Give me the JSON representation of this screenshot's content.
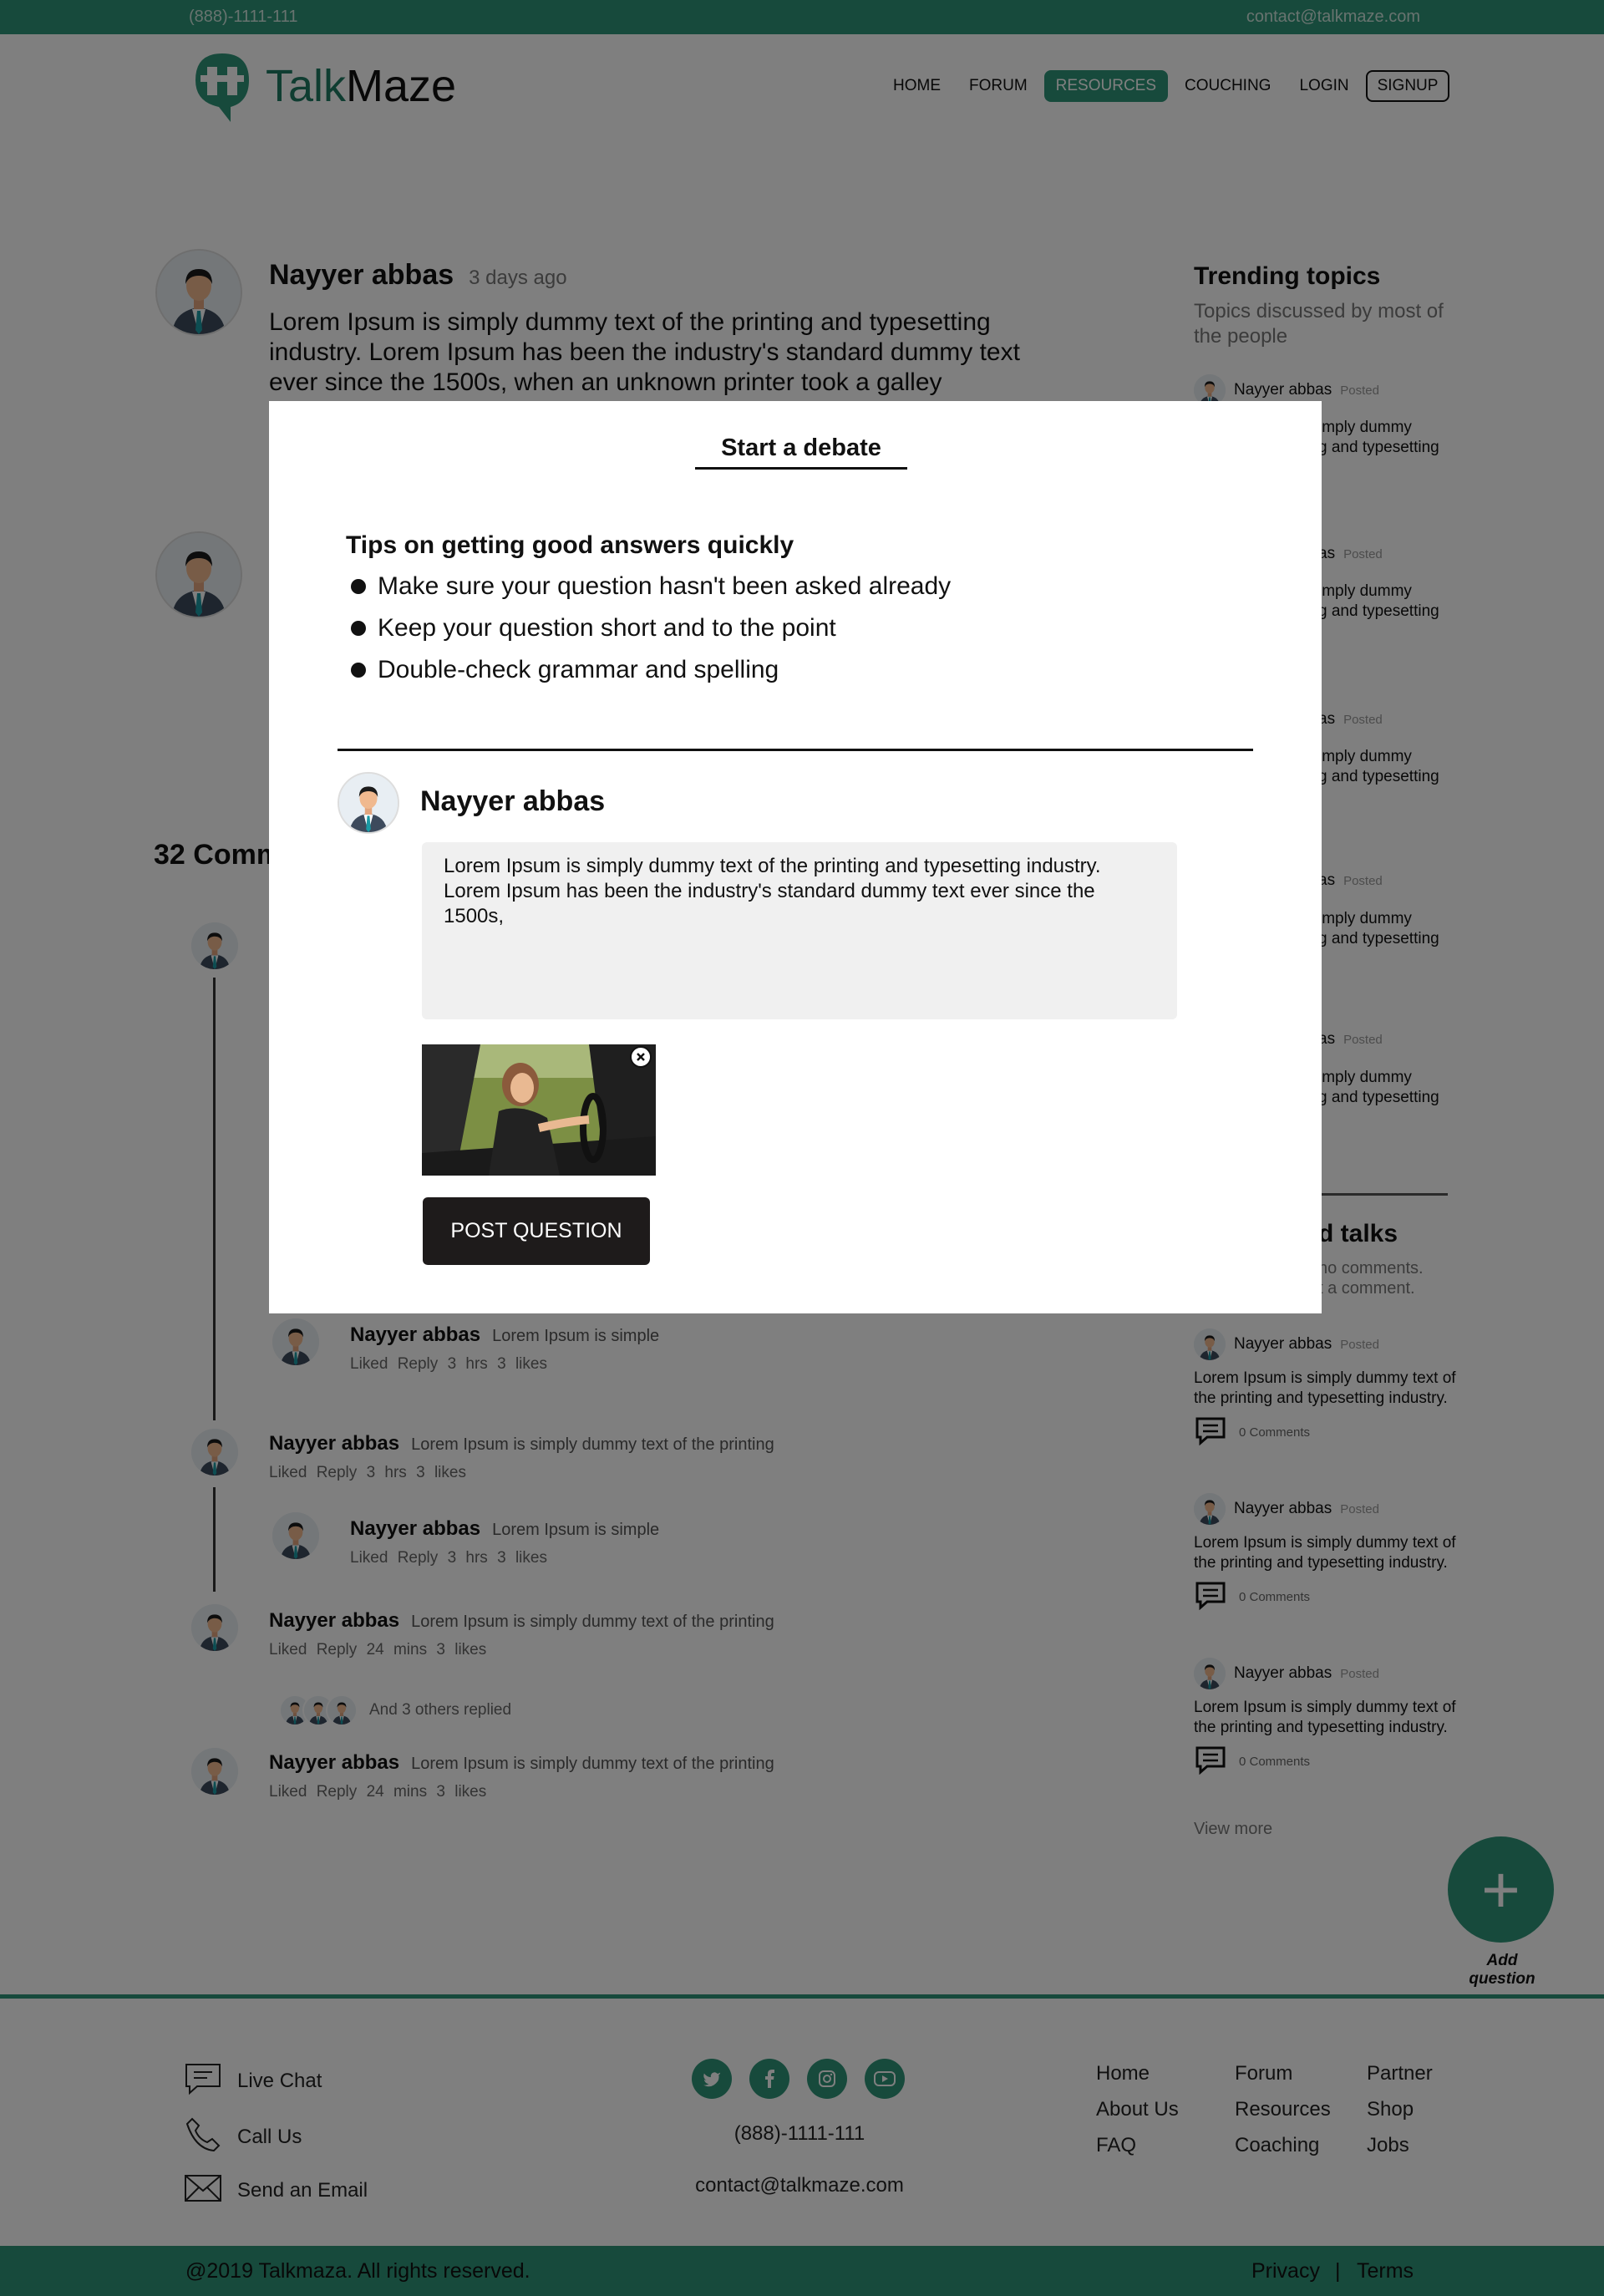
{
  "topbar": {
    "phone": "(888)-1111-111",
    "email": "contact@talkmaze.com"
  },
  "brand": {
    "part1": "Talk",
    "part2": "Maze",
    "accent": "#2f9478"
  },
  "nav": {
    "home": "HOME",
    "forum": "FORUM",
    "resources": "RESOURCES",
    "couching": "COUCHING",
    "login": "LOGIN",
    "signup": "SIGNUP"
  },
  "post": {
    "author": "Nayyer abbas",
    "time": "3 days ago",
    "body": "Lorem Ipsum is simply dummy text of the printing and typesetting industry. Lorem Ipsum has been the industry's standard dummy text ever since the 1500s, when an unknown printer took a galley"
  },
  "comments_header": "32 Comm",
  "comments": [
    {
      "author": "Nayyer abbas",
      "text": "Lorem Ipsum is simple",
      "liked": "Liked",
      "reply": "Reply",
      "time": "3 hrs",
      "likes": "3 likes"
    },
    {
      "author": "Nayyer abbas",
      "text": "Lorem Ipsum is simply dummy text of the printing",
      "liked": "Liked",
      "reply": "Reply",
      "time": "3 hrs",
      "likes": "3 likes"
    },
    {
      "author": "Nayyer abbas",
      "text": "Lorem Ipsum is simple",
      "liked": "Liked",
      "reply": "Reply",
      "time": "3 hrs",
      "likes": "3 likes"
    },
    {
      "author": "Nayyer abbas",
      "text": "Lorem Ipsum is simply dummy text of the printing",
      "liked": "Liked",
      "reply": "Reply",
      "time": "24 mins",
      "likes": "3 likes"
    },
    {
      "author": "Nayyer abbas",
      "text": "Lorem Ipsum is simply dummy text of the printing",
      "liked": "Liked",
      "reply": "Reply",
      "time": "24 mins",
      "likes": "3 likes"
    }
  ],
  "others_replied": "And 3 others replied",
  "sidebar": {
    "trending_title": "Trending topics",
    "trending_sub": "Topics discussed by most of the people",
    "trending_items": [
      {
        "author": "Nayyer abbas",
        "posted": "Posted",
        "body_tail": "imply dummy",
        "body_tail2": "g and typesetting"
      },
      {
        "author_tail": "as",
        "posted": "Posted",
        "body_tail": "imply dummy",
        "body_tail2": "g and typesetting"
      },
      {
        "author_tail": "as",
        "posted": "Posted",
        "body_tail": "imply dummy",
        "body_tail2": "g and typesetting"
      },
      {
        "author_tail": "as",
        "posted": "Posted",
        "body_tail": "imply dummy",
        "body_tail2": "g and typesetting"
      },
      {
        "author_tail": "as",
        "posted": "Posted",
        "body_tail": "imply dummy",
        "body_tail2": "g and typesetting"
      }
    ],
    "related_title_tail": "d talks",
    "related_sub1": "no comments.",
    "related_sub2": "t a comment.",
    "related_items": [
      {
        "author": "Nayyer abbas",
        "posted": "Posted",
        "body": "Lorem Ipsum is simply dummy text of the printing and typesetting industry.",
        "comments": "0 Comments"
      },
      {
        "author": "Nayyer abbas",
        "posted": "Posted",
        "body": "Lorem Ipsum is simply dummy text of the printing and typesetting industry.",
        "comments": "0 Comments"
      },
      {
        "author": "Nayyer abbas",
        "posted": "Posted",
        "body": "Lorem Ipsum is simply dummy text of the printing and typesetting industry.",
        "comments": "0 Comments"
      }
    ],
    "view_more": "View more"
  },
  "fab": {
    "symbol": "+",
    "label": "Add question"
  },
  "modal": {
    "title": "Start a debate",
    "tips_title": "Tips on getting good answers quickly",
    "tips": [
      "Make sure your question hasn't been asked already",
      "Keep your question short and to the point",
      "Double-check grammar and spelling"
    ],
    "author": "Nayyer abbas",
    "question_text": "Lorem Ipsum is simply dummy text of the printing and typesetting industry. Lorem Ipsum has been the industry's standard dummy text ever since the 1500s,",
    "post_button": "POST QUESTION"
  },
  "footer": {
    "live_chat": "Live Chat",
    "call_us": "Call Us",
    "send_email": "Send an Email",
    "phone": "(888)-1111-111",
    "email": "contact@talkmaze.com",
    "col1": [
      "Home",
      "About Us",
      "FAQ"
    ],
    "col2": [
      "Forum",
      "Resources",
      "Coaching"
    ],
    "col3": [
      "Partner",
      "Shop",
      "Jobs"
    ],
    "copyright": "@2019 Talkmaza. All rights reserved.",
    "privacy": "Privacy",
    "separator": "|",
    "terms": "Terms"
  }
}
